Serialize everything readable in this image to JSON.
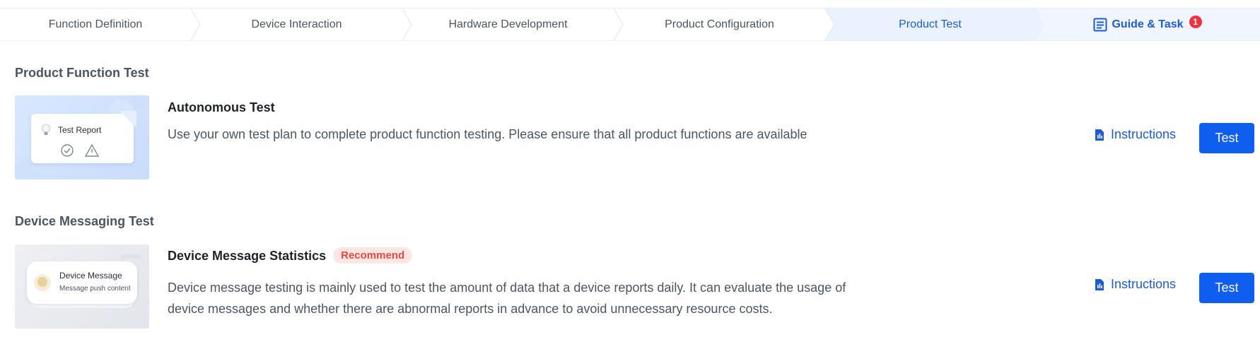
{
  "steps": [
    {
      "label": "Function Definition"
    },
    {
      "label": "Device Interaction"
    },
    {
      "label": "Hardware Development"
    },
    {
      "label": "Product Configuration"
    },
    {
      "label": "Product Test",
      "active": true
    }
  ],
  "guide": {
    "label": "Guide & Task",
    "badge": "1"
  },
  "sections": [
    {
      "title": "Product Function Test",
      "card": {
        "title": "Autonomous Test",
        "desc": "Use your own test plan to complete product function testing. Please ensure that all product functions are available",
        "thumb_label": "Test Report",
        "instructions": "Instructions",
        "button": "Test"
      }
    },
    {
      "title": "Device Messaging Test",
      "card": {
        "title": "Device Message Statistics",
        "tag": "Recommend",
        "desc": "Device message testing is mainly used to test the amount of data that a device reports daily. It can evaluate the usage of device messages and whether there are abnormal reports in advance to avoid unnecessary resource costs.",
        "thumb_label": "Device Message",
        "thumb_sub": "Message push content",
        "instructions": "Instructions",
        "button": "Test"
      }
    }
  ],
  "colors": {
    "accent": "#0f5ef0",
    "active_step_bg": "#eaf2ff",
    "tag_bg": "#fde6e4",
    "tag_text": "#e5483f"
  }
}
